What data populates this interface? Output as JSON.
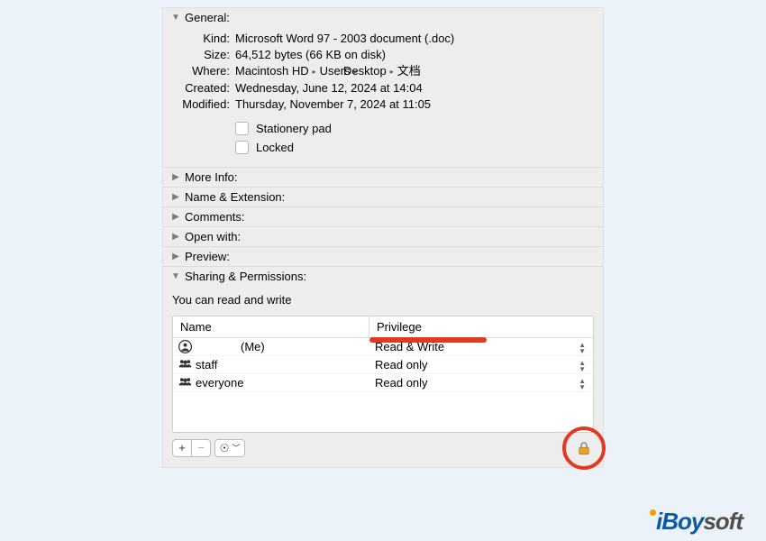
{
  "sections": {
    "general": {
      "title": "General:"
    },
    "more_info": {
      "title": "More Info:"
    },
    "name_ext": {
      "title": "Name & Extension:"
    },
    "comments": {
      "title": "Comments:"
    },
    "open_with": {
      "title": "Open with:"
    },
    "preview": {
      "title": "Preview:"
    },
    "sharing": {
      "title": "Sharing & Permissions:"
    }
  },
  "general": {
    "kind_label": "Kind:",
    "kind_value": "Microsoft Word 97 - 2003 document (.doc)",
    "size_label": "Size:",
    "size_value": "64,512 bytes (66 KB on disk)",
    "where_label": "Where:",
    "where_value_1": "Macintosh HD",
    "where_value_2": "Users",
    "where_value_3": "Desktop",
    "where_value_4": "文档",
    "created_label": "Created:",
    "created_value": "Wednesday, June 12, 2024 at 14:04",
    "modified_label": "Modified:",
    "modified_value": "Thursday, November 7, 2024 at 11:05",
    "stationery_label": "Stationery pad",
    "locked_label": "Locked"
  },
  "sharing": {
    "caption": "You can read and write",
    "col_name": "Name",
    "col_priv": "Privilege",
    "rows": [
      {
        "name_suffix": "(Me)",
        "priv": "Read & Write"
      },
      {
        "name": "staff",
        "priv": "Read only"
      },
      {
        "name": "everyone",
        "priv": "Read only"
      }
    ]
  },
  "toolbar": {
    "add": "+",
    "remove": "−",
    "action": "⊙"
  },
  "brand": {
    "i": "iBoy",
    "soft": "soft"
  }
}
